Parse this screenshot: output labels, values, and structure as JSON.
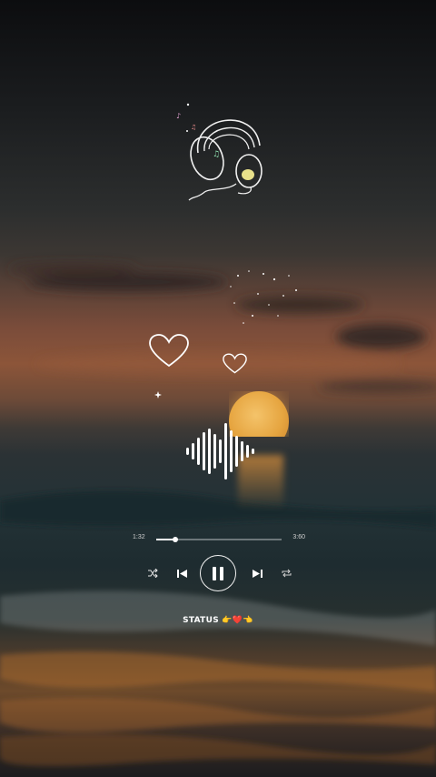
{
  "player": {
    "current_time": "1:32",
    "total_time": "3:60",
    "progress_fraction": 0.15,
    "shuffle_icon": "shuffle-icon",
    "prev_icon": "skip-previous-icon",
    "play_state_icon": "pause-icon",
    "next_icon": "skip-next-icon",
    "repeat_icon": "repeat-icon"
  },
  "caption": {
    "status_text": "STATUS 👉❤️👈"
  },
  "colors": {
    "moon": "#e6a540",
    "accent_white": "#ffffff",
    "sky_top": "#0c0d0f",
    "sunset": "#8c5539"
  },
  "decor": {
    "headphones_icon": "headphones-music-icon",
    "heart_icon": "heart-outline-icon",
    "equalizer_icon": "sound-wave-icon"
  }
}
